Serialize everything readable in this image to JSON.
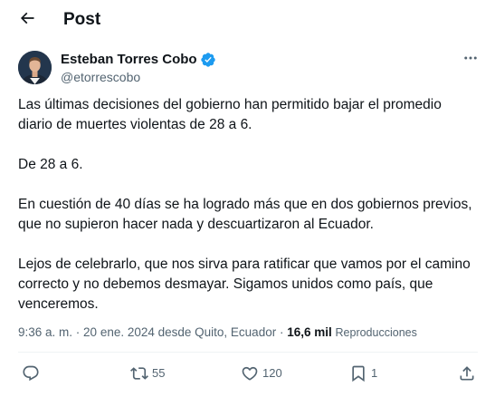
{
  "header": {
    "title": "Post",
    "back_icon": "arrow-left-icon"
  },
  "author": {
    "name": "Esteban Torres Cobo",
    "handle": "@etorrescobo",
    "verified": true,
    "verified_color": "#1d9bf0"
  },
  "tweet": {
    "paragraphs": [
      "Las últimas decisiones del gobierno han permitido bajar el promedio diario de muertes violentas de 28 a 6.",
      "De 28 a 6.",
      "En cuestión de 40 días se ha logrado más que en dos gobiernos previos, que no supieron hacer nada y descuartizaron al Ecuador.",
      "Lejos de celebrarlo, que nos sirva para ratificar que vamos por el camino correcto y no debemos desmayar. Sigamos unidos como país, que venceremos."
    ]
  },
  "meta": {
    "time": "9:36 a. m.",
    "separator": " · ",
    "date_location": "20 ene. 2024 desde Quito, Ecuador",
    "views_count": "16,6 mil",
    "views_label": "Reproducciones"
  },
  "actions": {
    "reply": {
      "icon": "reply-icon",
      "count": ""
    },
    "repost": {
      "icon": "repost-icon",
      "count": "55"
    },
    "like": {
      "icon": "heart-icon",
      "count": "120"
    },
    "bookmark": {
      "icon": "bookmark-icon",
      "count": "1"
    },
    "share": {
      "icon": "share-icon",
      "count": ""
    }
  },
  "colors": {
    "text": "#0f1419",
    "secondary": "#536471",
    "accent": "#1d9bf0",
    "divider": "#eff3f4"
  }
}
